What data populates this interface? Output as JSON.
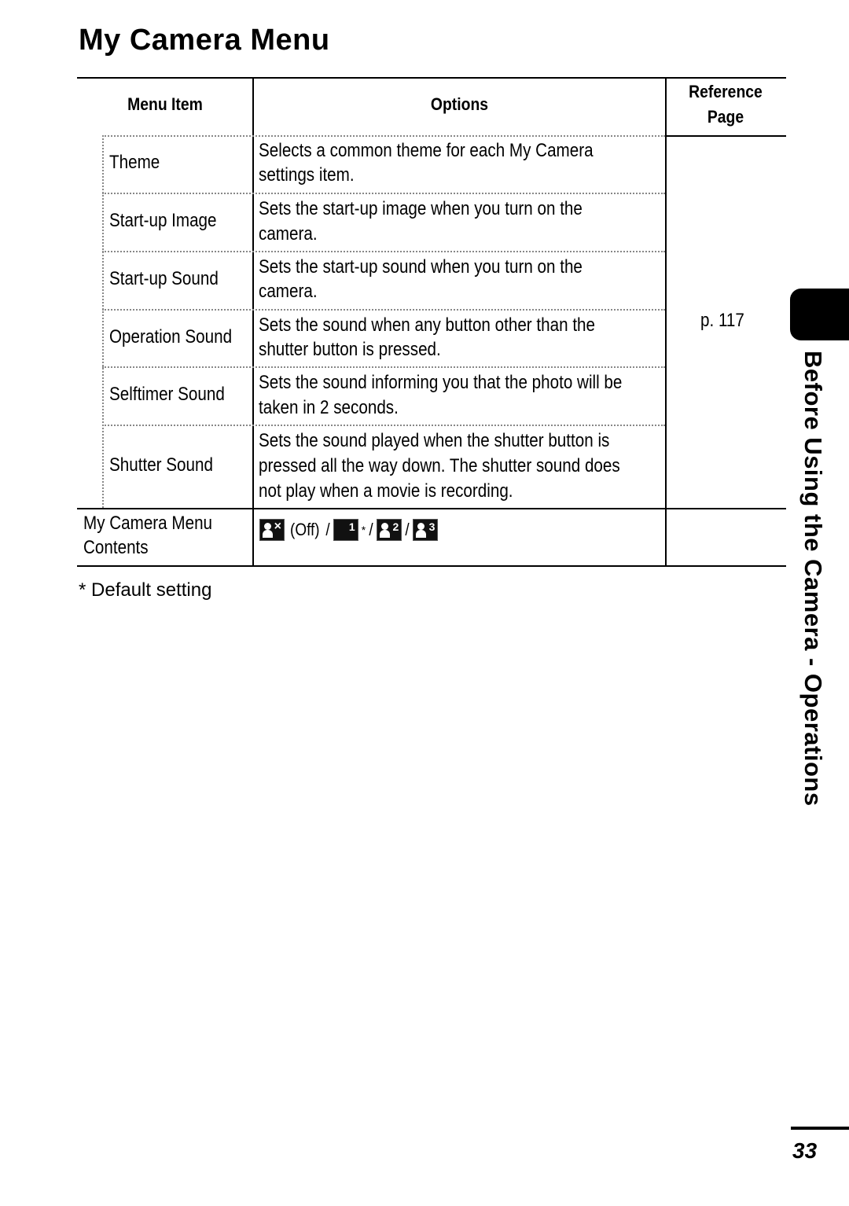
{
  "page": {
    "title": "My Camera Menu",
    "side_tab_label": "Before Using the Camera - Operations",
    "page_number": "33"
  },
  "table": {
    "headers": {
      "menu_item": "Menu Item",
      "options": "Options",
      "reference_line1": "Reference",
      "reference_line2": "Page"
    },
    "sub_rows": [
      {
        "item": "Theme",
        "option_lines": [
          "Selects a common theme for each My Camera",
          "settings item."
        ]
      },
      {
        "item": "Start-up Image",
        "option_lines": [
          "Sets the start-up image when you turn on the",
          "camera."
        ]
      },
      {
        "item": "Start-up Sound",
        "option_lines": [
          "Sets the start-up sound when you turn on the",
          "camera."
        ]
      },
      {
        "item": "Operation Sound",
        "option_lines": [
          "Sets the sound when any button other than the",
          "shutter button is pressed."
        ]
      },
      {
        "item": "Selftimer Sound",
        "option_lines": [
          "Sets the sound informing you that the photo will be",
          "taken in 2 seconds."
        ]
      },
      {
        "item": "Shutter Sound",
        "option_lines": [
          "Sets the sound played when the shutter button is",
          "pressed all the way down. The shutter sound does",
          "not play when a movie is recording."
        ]
      }
    ],
    "reference_page": "p. 117",
    "contents_row": {
      "item_lines": [
        "My Camera Menu",
        "Contents"
      ],
      "options": [
        {
          "icon": "my-camera-off-icon",
          "label": "(Off)"
        },
        {
          "icon": "my-camera-theme-1-icon",
          "label": "1",
          "default_marker": "*"
        },
        {
          "icon": "my-camera-theme-2-icon",
          "label": "2"
        },
        {
          "icon": "my-camera-theme-3-icon",
          "label": "3"
        }
      ],
      "separator": "/"
    }
  },
  "footnote": "*  Default setting"
}
